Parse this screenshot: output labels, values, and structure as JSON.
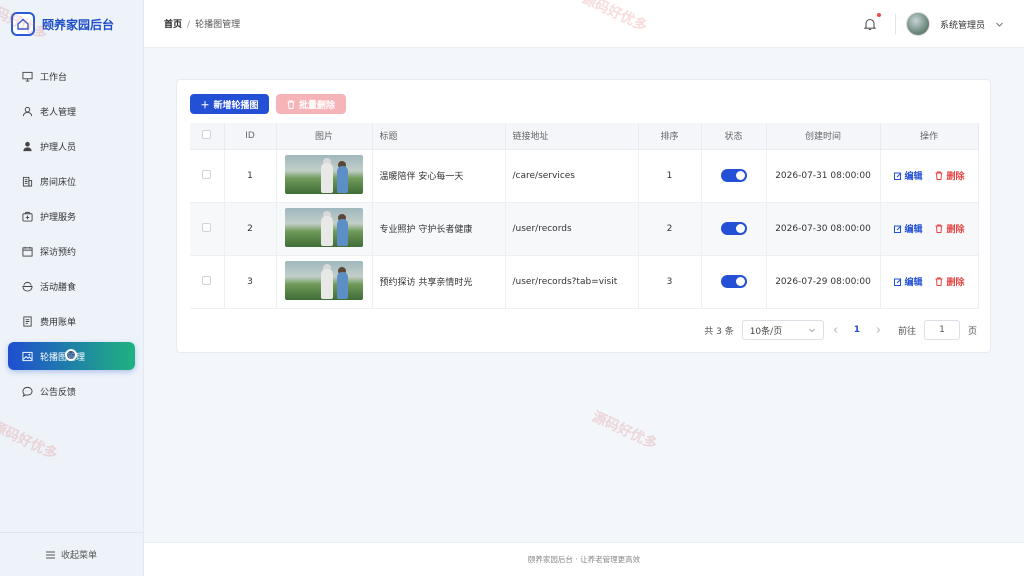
{
  "app": {
    "title": "颐养家园后台"
  },
  "sidebar": {
    "items": [
      {
        "label": "工作台",
        "icon": "monitor-icon"
      },
      {
        "label": "老人管理",
        "icon": "user-icon"
      },
      {
        "label": "护理人员",
        "icon": "person-icon"
      },
      {
        "label": "房间床位",
        "icon": "building-icon"
      },
      {
        "label": "护理服务",
        "icon": "medical-icon"
      },
      {
        "label": "探访预约",
        "icon": "calendar-icon"
      },
      {
        "label": "活动膳食",
        "icon": "food-icon"
      },
      {
        "label": "费用账单",
        "icon": "bill-icon"
      },
      {
        "label": "轮播图管理",
        "icon": "image-icon",
        "active": true
      },
      {
        "label": "公告反馈",
        "icon": "chat-icon"
      }
    ],
    "collapse_label": "收起菜单"
  },
  "header": {
    "breadcrumb_home": "首页",
    "breadcrumb_sep": "/",
    "breadcrumb_current": "轮播图管理",
    "user_name": "系统管理员"
  },
  "toolbar": {
    "add_label": "新增轮播图",
    "batch_delete_label": "批量删除"
  },
  "table": {
    "columns": [
      "ID",
      "图片",
      "标题",
      "链接地址",
      "排序",
      "状态",
      "创建时间",
      "操作"
    ],
    "rows": [
      {
        "id": "1",
        "title": "温暖陪伴 安心每一天",
        "link": "/care/services",
        "sort": "1",
        "status": true,
        "created": "2026-07-31 08:00:00"
      },
      {
        "id": "2",
        "title": "专业照护 守护长者健康",
        "link": "/user/records",
        "sort": "2",
        "status": true,
        "created": "2026-07-30 08:00:00"
      },
      {
        "id": "3",
        "title": "预约探访 共享亲情时光",
        "link": "/user/records?tab=visit",
        "sort": "3",
        "status": true,
        "created": "2026-07-29 08:00:00"
      }
    ],
    "edit_label": "编辑",
    "delete_label": "删除"
  },
  "pagination": {
    "total_text": "共 3 条",
    "page_size": "10条/页",
    "current_page": "1",
    "goto_prefix": "前往",
    "goto_value": "1",
    "goto_suffix": "页"
  },
  "footer": {
    "text": "颐养家园后台 · 让养老管理更高效"
  },
  "watermark": {
    "text": "源码好优多"
  },
  "colors": {
    "primary": "#2450d5",
    "accent": "#1fb37f",
    "danger": "#e64545"
  }
}
